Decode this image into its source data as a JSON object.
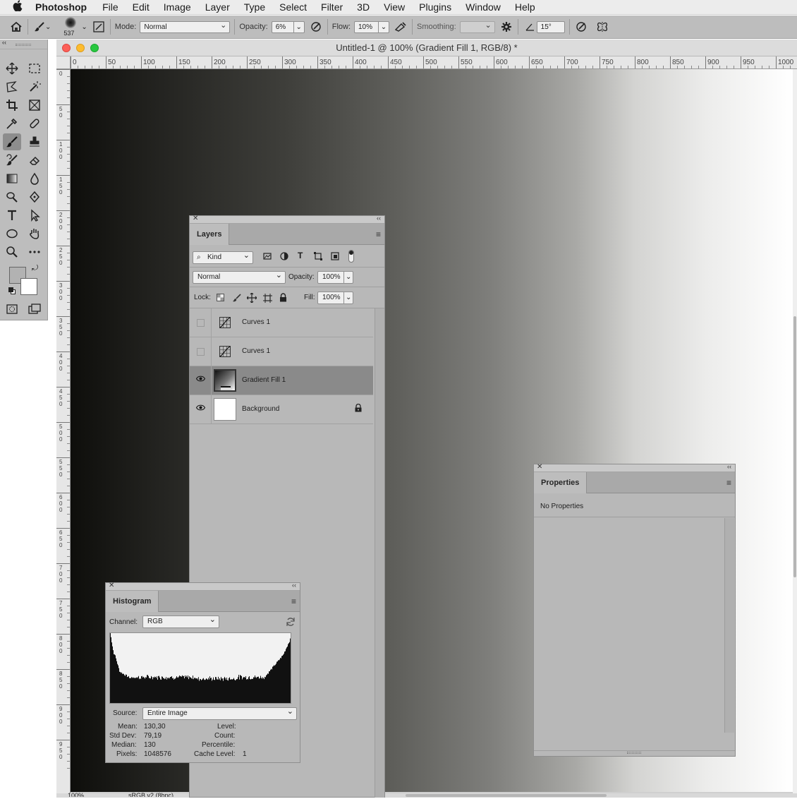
{
  "menubar": {
    "apple": "",
    "items": [
      "Photoshop",
      "File",
      "Edit",
      "Image",
      "Layer",
      "Type",
      "Select",
      "Filter",
      "3D",
      "View",
      "Plugins",
      "Window",
      "Help"
    ]
  },
  "options": {
    "brush_size": "537",
    "mode_label": "Mode:",
    "mode_value": "Normal",
    "opacity_label": "Opacity:",
    "opacity_value": "6%",
    "flow_label": "Flow:",
    "flow_value": "10%",
    "smoothing_label": "Smoothing:",
    "smoothing_value": "",
    "angle_value": "15°"
  },
  "document": {
    "title": "Untitled-1 @ 100% (Gradient Fill 1, RGB/8) *",
    "ruler_top": [
      "0",
      "50",
      "100",
      "150",
      "200",
      "250",
      "300",
      "350",
      "400",
      "450",
      "500",
      "550",
      "600",
      "650",
      "700",
      "750",
      "800",
      "850",
      "900",
      "950",
      "1000"
    ],
    "ruler_left": [
      "0",
      "5\n0",
      "1\n0\n0",
      "1\n5\n0",
      "2\n0\n0",
      "2\n5\n0",
      "3\n0\n0",
      "3\n5\n0",
      "4\n0\n0",
      "4\n5\n0",
      "5\n0\n0",
      "5\n5\n0",
      "6\n0\n0",
      "6\n5\n0",
      "7\n0\n0",
      "7\n5\n0",
      "8\n0\n0",
      "8\n5\n0",
      "9\n0\n0",
      "9\n5\n0"
    ],
    "zoom": "100%",
    "profile": "sRGB v2 (8bpc)"
  },
  "layers": {
    "title": "Layers",
    "filter_kind": "Kind",
    "blend_mode": "Normal",
    "opacity_label": "Opacity:",
    "opacity_value": "100%",
    "lock_label": "Lock:",
    "fill_label": "Fill:",
    "fill_value": "100%",
    "rows": [
      {
        "name": "Curves 1",
        "visible": false
      },
      {
        "name": "Curves 1",
        "visible": false
      },
      {
        "name": "Gradient Fill 1",
        "visible": true,
        "selected": true
      },
      {
        "name": "Background",
        "visible": true,
        "locked": true
      }
    ]
  },
  "properties": {
    "title": "Properties",
    "message": "No Properties"
  },
  "histogram": {
    "title": "Histogram",
    "channel_label": "Channel:",
    "channel_value": "RGB",
    "source_label": "Source:",
    "source_value": "Entire Image",
    "mean_label": "Mean:",
    "mean_value": "130,30",
    "stddev_label": "Std Dev:",
    "stddev_value": "79,19",
    "median_label": "Median:",
    "median_value": "130",
    "pixels_label": "Pixels:",
    "pixels_value": "1048576",
    "level_label": "Level:",
    "count_label": "Count:",
    "percentile_label": "Percentile:",
    "cache_label": "Cache Level:",
    "cache_value": "1"
  },
  "colors": {
    "foreground": "#b2b2b2",
    "background": "#ffffff"
  }
}
